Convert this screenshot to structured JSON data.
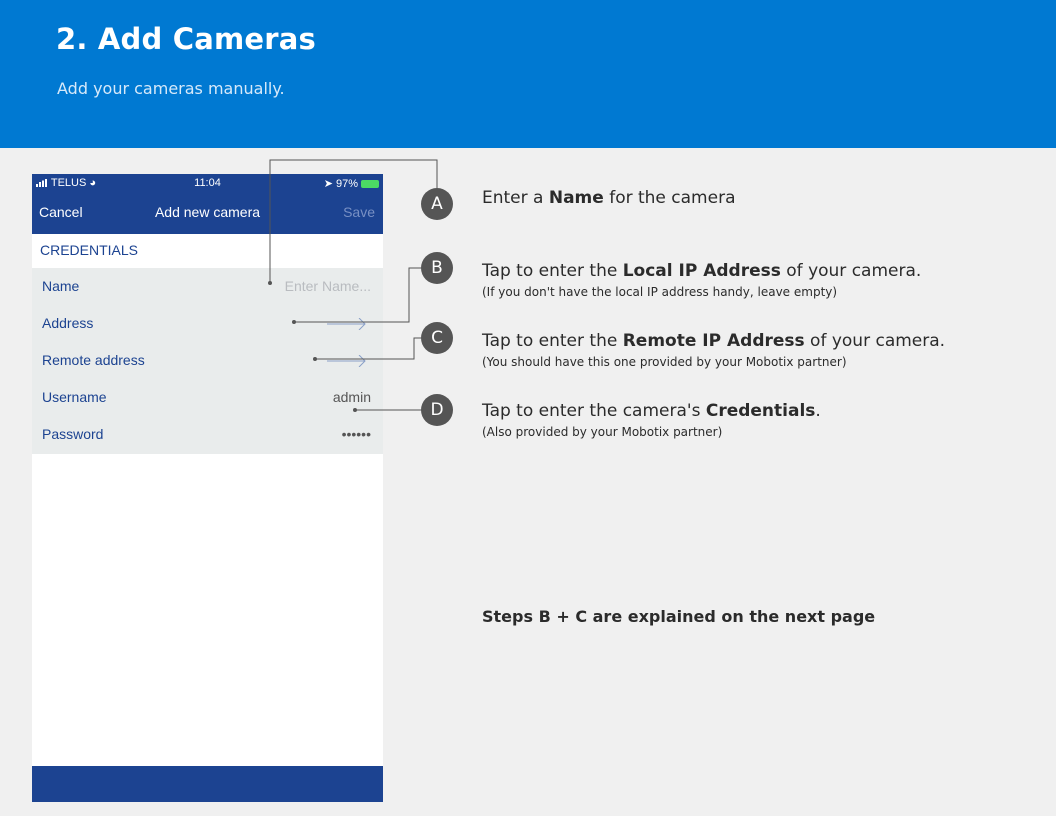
{
  "header": {
    "title": "2. Add Cameras",
    "subtitle": "Add your cameras manually."
  },
  "phone": {
    "status_bar": {
      "carrier": "TELUS",
      "time": "11:04",
      "battery": "97%"
    },
    "nav": {
      "cancel_label": "Cancel",
      "title": "Add new camera",
      "save_label": "Save"
    },
    "section_header": "CREDENTIALS",
    "fields": {
      "name": {
        "label": "Name",
        "placeholder": "Enter Name..."
      },
      "address": {
        "label": "Address"
      },
      "remote_address": {
        "label": "Remote address"
      },
      "username": {
        "label": "Username",
        "value": "admin"
      },
      "password": {
        "label": "Password",
        "value": "••••••"
      }
    }
  },
  "steps": [
    {
      "badge": "A",
      "pre": "Enter a ",
      "bold": "Name",
      "post": " for the camera",
      "note": ""
    },
    {
      "badge": "B",
      "pre": "Tap to enter the ",
      "bold": "Local IP Address",
      "post": " of your camera.",
      "note": "(If you don't have the local IP address handy, leave empty)"
    },
    {
      "badge": "C",
      "pre": "Tap to enter the ",
      "bold": "Remote IP Address",
      "post": " of your camera.",
      "note": "(You should have this one provided by your Mobotix partner)"
    },
    {
      "badge": "D",
      "pre": "Tap to enter the camera's ",
      "bold": "Credentials",
      "post": ".",
      "note": "(Also provided by your Mobotix partner)"
    }
  ],
  "footnote": "Steps B + C are explained on the next page",
  "colors": {
    "banner": "#0079d2",
    "nav": "#1c4391",
    "badge": "#555555"
  }
}
